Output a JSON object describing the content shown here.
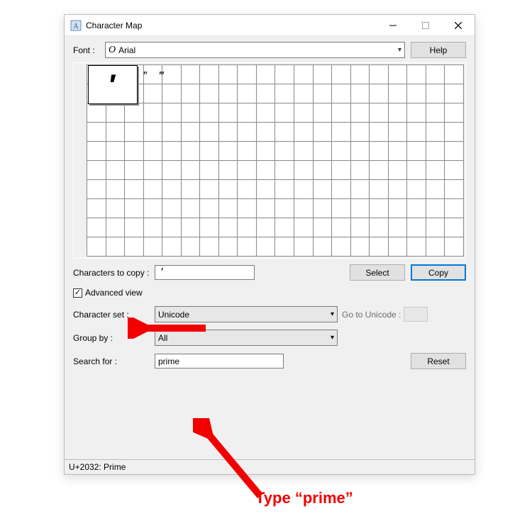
{
  "window": {
    "title": "Character Map"
  },
  "toolbar": {
    "font_label": "Font :",
    "font_selected": "Arial",
    "help_label": "Help"
  },
  "grid": {
    "priming_chars": [
      "″",
      "‴"
    ],
    "zoom_char": "′"
  },
  "copy_section": {
    "label": "Characters to copy :",
    "value": "′",
    "select_label": "Select",
    "copy_label": "Copy"
  },
  "advanced": {
    "checkbox_label": "Advanced view",
    "checked": true,
    "character_set_label": "Character set :",
    "character_set_value": "Unicode",
    "goto_label": "Go to Unicode :",
    "group_by_label": "Group by :",
    "group_by_value": "All",
    "search_label": "Search for :",
    "search_value": "prime",
    "reset_label": "Reset"
  },
  "status": {
    "text": "U+2032: Prime"
  },
  "annotation": {
    "text": "Type “prime”"
  }
}
